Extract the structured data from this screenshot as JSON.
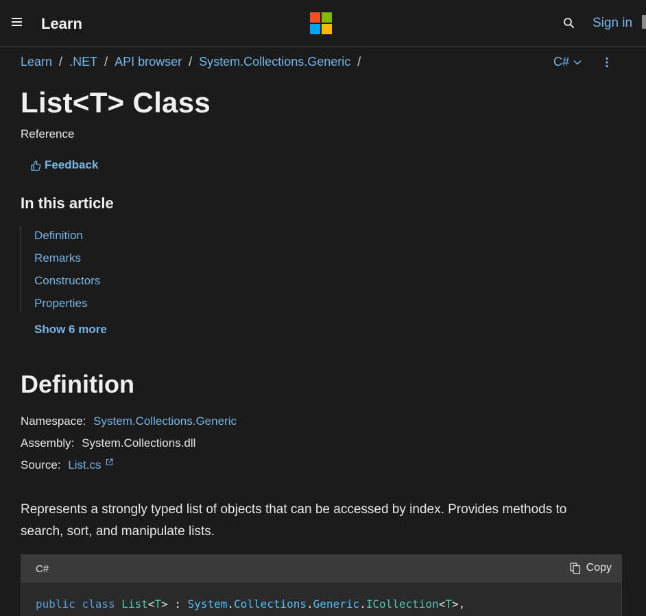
{
  "header": {
    "brand": "Learn",
    "signin_label": "Sign in",
    "logo_colors": [
      "#f25022",
      "#7fba00",
      "#00a4ef",
      "#ffb900"
    ]
  },
  "breadcrumb": {
    "items": [
      "Learn",
      ".NET",
      "API browser",
      "System.Collections.Generic"
    ],
    "separator": "/"
  },
  "language_picker": {
    "selected": "C#"
  },
  "page": {
    "title": "List<T> Class",
    "subtitle": "Reference",
    "feedback_label": "Feedback"
  },
  "toc": {
    "heading": "In this article",
    "items": [
      "Definition",
      "Remarks",
      "Constructors",
      "Properties"
    ],
    "show_more_label": "Show 6 more"
  },
  "definition": {
    "heading": "Definition",
    "namespace_label": "Namespace:",
    "namespace_value": "System.Collections.Generic",
    "assembly_label": "Assembly:",
    "assembly_value": "System.Collections.dll",
    "source_label": "Source:",
    "source_value": "List.cs",
    "summary": "Represents a strongly typed list of objects that can be accessed by index. Provides methods to search, sort, and manipulate lists."
  },
  "code": {
    "language": "C#",
    "copy_label": "Copy",
    "tokens": [
      "public",
      "class",
      "List",
      "<",
      "T",
      ">",
      " : ",
      "System",
      ".",
      "Collections",
      ".",
      "Generic",
      ".",
      "ICollection",
      "<",
      "T",
      ">,"
    ]
  },
  "colors": {
    "background": "#1b1b1b",
    "link": "#75b6e7",
    "code_background": "#2a2a2a"
  }
}
